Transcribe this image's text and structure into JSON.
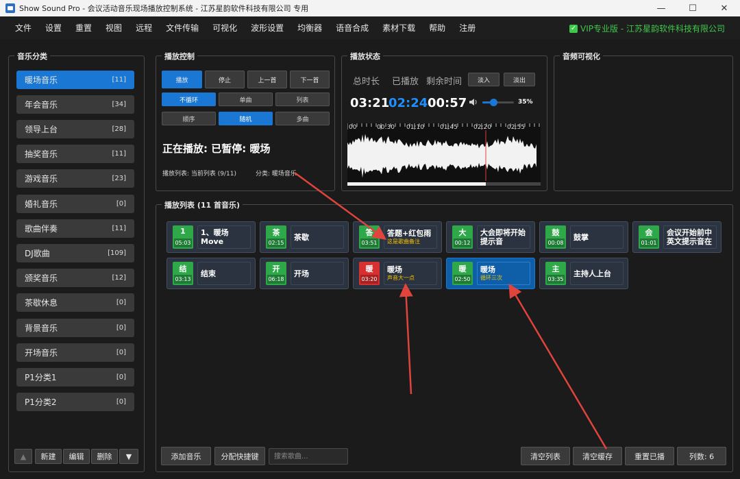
{
  "window": {
    "title": "Show Sound Pro - 会议活动音乐现场播放控制系统 - 江苏星韵软件科技有限公司 专用",
    "controls": [
      "—",
      "☐",
      "✕"
    ]
  },
  "menu": {
    "items": [
      "文件",
      "设置",
      "重置",
      "视图",
      "远程",
      "文件传输",
      "可视化",
      "波形设置",
      "均衡器",
      "语音合成",
      "素材下载",
      "帮助",
      "注册"
    ],
    "vip": "VIP专业版 - 江苏星韵软件科技有限公司"
  },
  "categories": {
    "title": "音乐分类",
    "items": [
      {
        "name": "暖场音乐",
        "count": "[11]",
        "active": true
      },
      {
        "name": "年会音乐",
        "count": "[34]"
      },
      {
        "name": "领导上台",
        "count": "[28]"
      },
      {
        "name": "抽奖音乐",
        "count": "[11]"
      },
      {
        "name": "游戏音乐",
        "count": "[23]"
      },
      {
        "name": "婚礼音乐",
        "count": "[0]"
      },
      {
        "name": "歌曲伴奏",
        "count": "[11]"
      },
      {
        "name": "DJ歌曲",
        "count": "[109]"
      },
      {
        "name": "颁奖音乐",
        "count": "[12]"
      },
      {
        "name": "茶歇休息",
        "count": "[0]"
      },
      {
        "name": "背景音乐",
        "count": "[0]"
      },
      {
        "name": "开场音乐",
        "count": "[0]"
      },
      {
        "name": "P1分类1",
        "count": "[0]"
      },
      {
        "name": "P1分类2",
        "count": "[0]"
      }
    ],
    "buttons": {
      "up": "▲",
      "new": "新建",
      "edit": "编辑",
      "delete": "删除",
      "down": "▼"
    }
  },
  "playback_control": {
    "title": "播放控制",
    "buttons": {
      "play": "播放",
      "stop": "停止",
      "prev": "上一首",
      "next": "下一首"
    },
    "loop_modes": [
      "不循环",
      "单曲",
      "列表"
    ],
    "order_modes": [
      "顺序",
      "随机",
      "多曲"
    ],
    "now_playing": "正在播放: 已暂停: 暖场",
    "playlist_info": "播放列表: 当前列表 (9/11)",
    "category_info": "分类: 暖场音乐"
  },
  "status": {
    "title": "播放状态",
    "labels": {
      "total": "总时长",
      "played": "已播放",
      "remaining": "剩余时间"
    },
    "times": {
      "total": "03:21",
      "played": "02:24",
      "remaining": "00:57"
    },
    "fade_in": "淡入",
    "fade_out": "淡出",
    "volume": "35%",
    "volume_fraction": 0.35,
    "progress_fraction": 0.717,
    "ruler": [
      "00",
      "00:30",
      "01:10",
      "01:45",
      "02:20",
      "02:55"
    ]
  },
  "visualizer": {
    "title": "音频可视化"
  },
  "playlist": {
    "title": "播放列表 (11 首音乐)",
    "tiles": [
      {
        "char": "1",
        "time": "05:03",
        "name": "1、暖场",
        "name2": "Move",
        "note": ""
      },
      {
        "char": "茶",
        "time": "02:15",
        "name": "茶歇",
        "name2": "",
        "note": ""
      },
      {
        "char": "答",
        "time": "03:51",
        "name": "答题+红包雨",
        "name2": "",
        "note": "这是歌曲备注"
      },
      {
        "char": "大",
        "time": "00:12",
        "name": "大会即将开始",
        "name2": "提示音",
        "note": ""
      },
      {
        "char": "鼓",
        "time": "00:08",
        "name": "鼓掌",
        "name2": "",
        "note": ""
      },
      {
        "char": "会",
        "time": "01:01",
        "name": "会议开始前中",
        "name2": "英文提示音在",
        "note": ""
      },
      {
        "char": "结",
        "time": "03:13",
        "name": "结束",
        "name2": "",
        "note": ""
      },
      {
        "char": "开",
        "time": "06:18",
        "name": "开场",
        "name2": "",
        "note": ""
      },
      {
        "char": "暖",
        "time": "03:20",
        "name": "暖场",
        "name2": "",
        "note": "声音大一点",
        "red": true
      },
      {
        "char": "暖",
        "time": "02:50",
        "name": "暖场",
        "name2": "",
        "note": "循环三次",
        "selected": true
      },
      {
        "char": "主",
        "time": "03:35",
        "name": "主持人上台",
        "name2": "",
        "note": ""
      }
    ],
    "buttons": {
      "add": "添加音乐",
      "hotkey": "分配快捷键",
      "clear_list": "清空列表",
      "clear_cache": "清空缓存",
      "reset_played": "重置已播",
      "columns": "列数: 6"
    },
    "search_placeholder": "搜索歌曲..."
  },
  "colors": {
    "accent": "#1a78d4",
    "badge_green": "#2fa84a",
    "badge_red": "#d83030",
    "note_yellow": "#f5c400",
    "vip_green": "#3ec84a",
    "arrow_red": "#e0443c"
  }
}
